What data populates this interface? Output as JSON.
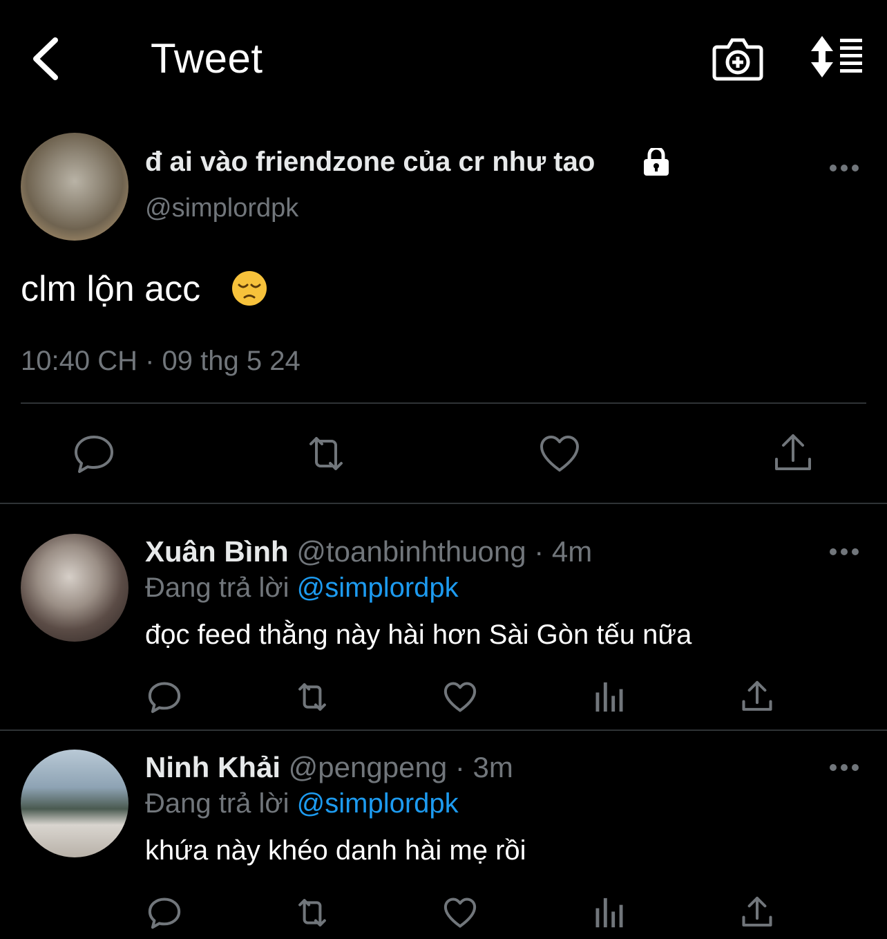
{
  "header": {
    "title": "Tweet",
    "back_icon": "chevron-left-icon",
    "camera_icon": "camera-plus-icon",
    "sort_icon": "sort-icon"
  },
  "tweet": {
    "display_name": "đ ai vào friendzone của cr như tao",
    "handle": "@simplordpk",
    "protected_icon": "lock-icon",
    "text": "clm lộn acc",
    "emoji": "pensive-face-icon",
    "timestamp": "10:40 CH · 09 thg 5 24",
    "actions": [
      "reply-icon",
      "retweet-icon",
      "like-icon",
      "share-icon"
    ]
  },
  "replies": [
    {
      "display_name": "Xuân Bình",
      "handle_time": "@toanbinhthuong · 4m",
      "replying_label": "Đang trả lời",
      "replying_to": "@simplordpk",
      "text": "đọc feed thằng này hài hơn Sài Gòn tếu nữa"
    },
    {
      "display_name": "Ninh Khải",
      "handle_time": "@pengpeng · 3m",
      "replying_label": "Đang trả lời",
      "replying_to": "@simplordpk",
      "text": "khứa này khéo danh hài mẹ rồi"
    }
  ],
  "colors": {
    "background": "#000000",
    "text": "#e7e9ea",
    "muted": "#71767b",
    "link": "#1d9bf0",
    "divider": "#2f3336"
  }
}
